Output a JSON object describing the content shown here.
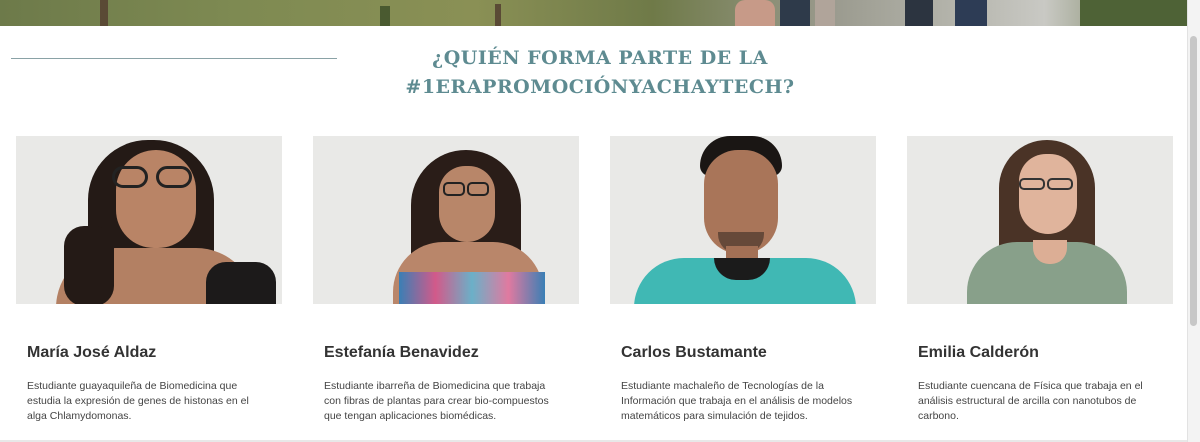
{
  "section": {
    "title_line1": "¿QUIÉN FORMA PARTE DE LA",
    "title_line2": "#1ERAPROMOCIÓNYACHAYTECH?"
  },
  "people": [
    {
      "name": "María José Aldaz",
      "description": "Estudiante guayaquileña de Biomedicina que estudia la expresión de genes de histonas en el alga Chlamydomonas."
    },
    {
      "name": "Estefanía Benavidez",
      "description": "Estudiante ibarreña de Biomedicina que trabaja con fibras de plantas para crear bio-compuestos que tengan aplicaciones biomédicas."
    },
    {
      "name": "Carlos Bustamante",
      "description": "Estudiante machaleño de Tecnologías de la Información que trabaja en el análisis de modelos matemáticos para simulación de tejidos."
    },
    {
      "name": "Emilia Calderón",
      "description": "Estudiante cuencana de Física que trabaja en el análisis estructural de arcilla con nanotubos de carbono."
    }
  ],
  "colors": {
    "title": "#5e8b91",
    "rule": "#8aa2a6",
    "name": "#333333",
    "text": "#444444"
  }
}
